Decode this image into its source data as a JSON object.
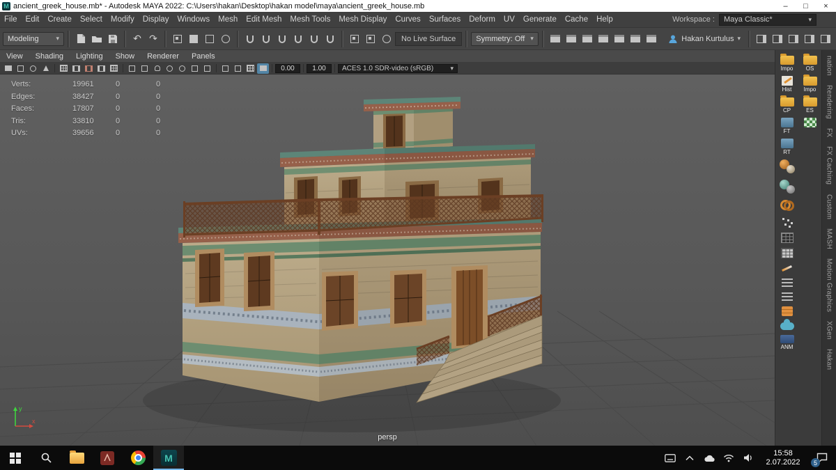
{
  "window": {
    "title": "ancient_greek_house.mb* - Autodesk MAYA 2022: C:\\Users\\hakan\\Desktop\\hakan model\\maya\\ancient_greek_house.mb"
  },
  "icons": {
    "maya_logo": "M",
    "minimize": "–",
    "maximize": "□",
    "close": "×",
    "dropdown": "▾",
    "undo": "↶",
    "redo": "↷"
  },
  "menu_bar": {
    "items": [
      "File",
      "Edit",
      "Create",
      "Select",
      "Modify",
      "Display",
      "Windows",
      "Mesh",
      "Edit Mesh",
      "Mesh Tools",
      "Mesh Display",
      "Curves",
      "Surfaces",
      "Deform",
      "UV",
      "Generate",
      "Cache",
      "Help"
    ],
    "workspace_label": "Workspace :",
    "workspace_value": "Maya Classic*"
  },
  "status_line": {
    "mode": "Modeling",
    "no_live_surface": "No Live Surface",
    "symmetry": "Symmetry: Off",
    "user": "Hakan Kurtulus"
  },
  "panel_menu": {
    "items": [
      "View",
      "Shading",
      "Lighting",
      "Show",
      "Renderer",
      "Panels"
    ]
  },
  "viewport_toolbar": {
    "exposure": "0.00",
    "gamma": "1.00",
    "color_space": "ACES 1.0 SDR-video (sRGB)"
  },
  "viewport": {
    "camera": "persp",
    "axis": {
      "x": "x",
      "y": "y"
    },
    "hud": {
      "rows": [
        {
          "label": "Verts:",
          "v1": "19961",
          "v2": "0",
          "v3": "0"
        },
        {
          "label": "Edges:",
          "v1": "38427",
          "v2": "0",
          "v3": "0"
        },
        {
          "label": "Faces:",
          "v1": "17807",
          "v2": "0",
          "v3": "0"
        },
        {
          "label": "Tris:",
          "v1": "33810",
          "v2": "0",
          "v3": "0"
        },
        {
          "label": "UVs:",
          "v1": "39656",
          "v2": "0",
          "v3": "0"
        }
      ]
    }
  },
  "right_panel": {
    "shelf_labels": [
      "Impo",
      "OS",
      "Hist",
      "Impo",
      "CP",
      "ES",
      "FT",
      "RT",
      "ANM"
    ],
    "tabs": [
      "nation",
      "Rendering",
      "FX",
      "FX Caching",
      "Custom",
      "MASH",
      "Motion Graphics",
      "XGen",
      "Hakan"
    ]
  },
  "taskbar": {
    "time": "15:58",
    "date": "2.07.2022",
    "badge": "5"
  },
  "colors": {
    "accent_blue": "#5285a6",
    "maya_teal": "#44c0b0",
    "stone": "#b3a181",
    "trim_green": "#6d8d70",
    "wood": "#6b4226",
    "cornice_brick": "#96604a"
  }
}
